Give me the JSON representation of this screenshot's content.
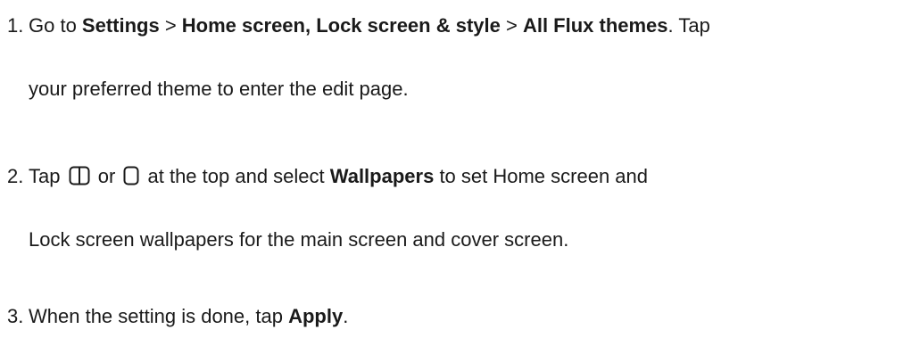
{
  "steps": [
    {
      "number": "1.",
      "line1": {
        "t1": "Go to ",
        "b1": "Settings",
        "t2": " > ",
        "b2": "Home screen, Lock screen & style",
        "t3": " > ",
        "b3": "All Flux themes",
        "t4": ". Tap"
      },
      "line2": "your preferred theme to enter the edit page."
    },
    {
      "number": "2.",
      "line1": {
        "t1": "Tap ",
        "t2": " or ",
        "t3": " at the top and select ",
        "b1": "Wallpapers",
        "t4": " to set Home screen and"
      },
      "icons": [
        "dual-screen-icon",
        "single-screen-icon"
      ],
      "line2": "Lock screen wallpapers for the main screen and cover screen."
    },
    {
      "number": "3.",
      "line1": {
        "t1": "When the setting is done, tap ",
        "b1": "Apply",
        "t2": "."
      }
    }
  ]
}
